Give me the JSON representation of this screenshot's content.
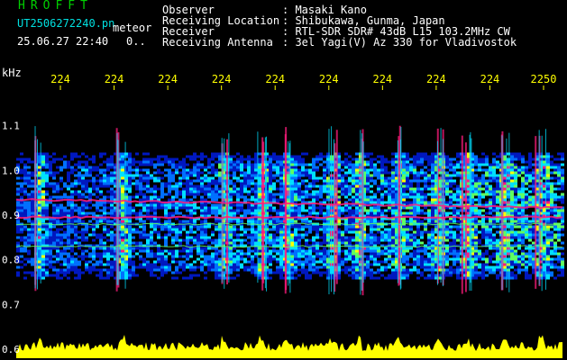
{
  "header": {
    "app_name": "HROFFT",
    "file_name": "UT2506272240.pn",
    "mode_label": "meteor",
    "timestamp": "25.06.27 22:40",
    "counter": "0.."
  },
  "info": [
    {
      "label": "Observer",
      "value": ": Masaki Kano"
    },
    {
      "label": "Receiving Location",
      "value": ": Shibukawa, Gunma, Japan"
    },
    {
      "label": "Receiver",
      "value": ": RTL-SDR SDR# 43dB L15 103.2MHz CW"
    },
    {
      "label": "Receiving Antenna",
      "value": ": 3el Yagi(V) Az 330 for Vladivostok"
    }
  ],
  "colors": {
    "text": "#ffffff",
    "info": "#00e0e0",
    "app_name": "#00d000",
    "axis": "#ffff00",
    "power_trace": "#ffff00"
  },
  "chart_data": {
    "type": "heatmap",
    "title": "",
    "ylabel": "kHz",
    "xlabel": "",
    "x_tick_labels": [
      "224",
      "224",
      "224",
      "224",
      "224",
      "224",
      "224",
      "224",
      "224",
      "2250"
    ],
    "y_ticks": [
      1.1,
      1.0,
      0.9,
      0.8,
      0.7,
      0.6
    ],
    "y_tick_labels": [
      "1.1",
      "1.0",
      "0.9",
      "0.8",
      "0.7",
      "0.6"
    ],
    "ylim": [
      0.58,
      1.19
    ],
    "signal_band_khz": [
      0.76,
      1.04
    ],
    "carrier_lines_khz": [
      0.935,
      0.895,
      0.83,
      0.88
    ],
    "grid": false,
    "palette": [
      "#000020",
      "#0018c0",
      "#0070ff",
      "#00e0ff",
      "#60ff60",
      "#ffff00",
      "#ff1c7c"
    ]
  }
}
